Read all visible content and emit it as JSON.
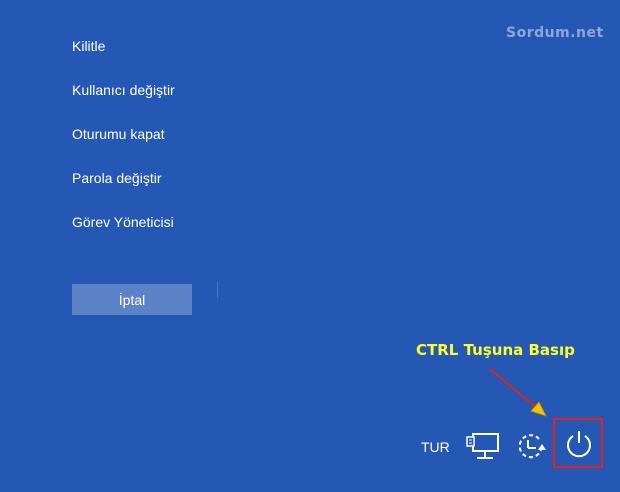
{
  "watermark": "Sordum.net",
  "menu": {
    "items": [
      {
        "label": "Kilitle"
      },
      {
        "label": "Kullanıcı değiştir"
      },
      {
        "label": "Oturumu kapat"
      },
      {
        "label": "Parola değiştir"
      },
      {
        "label": "Görev Yöneticisi"
      }
    ],
    "cancel_label": "İptal"
  },
  "annotation": {
    "text": "CTRL Tuşuna Basıp",
    "color": "#ffff2e",
    "arrow_color": "#e0231b"
  },
  "tray": {
    "language": "TUR",
    "icons": [
      "network-icon",
      "ease-of-access-icon",
      "power-icon"
    ]
  },
  "colors": {
    "background": "#2458b4",
    "cancel_button": "#5c82c7",
    "highlight_box": "#e0231b"
  }
}
